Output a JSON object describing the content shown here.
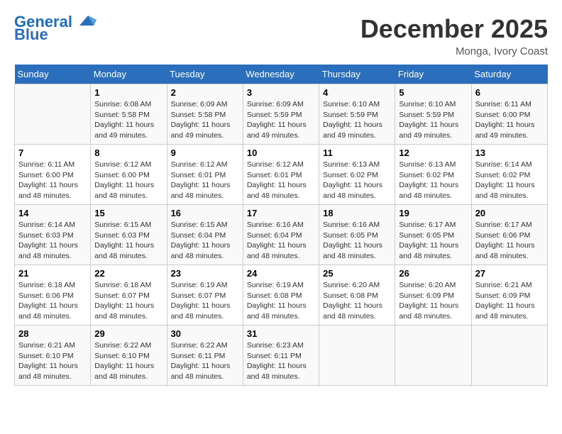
{
  "header": {
    "logo_line1": "General",
    "logo_line2": "Blue",
    "month_title": "December 2025",
    "location": "Monga, Ivory Coast"
  },
  "days_of_week": [
    "Sunday",
    "Monday",
    "Tuesday",
    "Wednesday",
    "Thursday",
    "Friday",
    "Saturday"
  ],
  "weeks": [
    [
      {
        "day": "",
        "info": ""
      },
      {
        "day": "1",
        "info": "Sunrise: 6:08 AM\nSunset: 5:58 PM\nDaylight: 11 hours and 49 minutes."
      },
      {
        "day": "2",
        "info": "Sunrise: 6:09 AM\nSunset: 5:58 PM\nDaylight: 11 hours and 49 minutes."
      },
      {
        "day": "3",
        "info": "Sunrise: 6:09 AM\nSunset: 5:59 PM\nDaylight: 11 hours and 49 minutes."
      },
      {
        "day": "4",
        "info": "Sunrise: 6:10 AM\nSunset: 5:59 PM\nDaylight: 11 hours and 49 minutes."
      },
      {
        "day": "5",
        "info": "Sunrise: 6:10 AM\nSunset: 5:59 PM\nDaylight: 11 hours and 49 minutes."
      },
      {
        "day": "6",
        "info": "Sunrise: 6:11 AM\nSunset: 6:00 PM\nDaylight: 11 hours and 49 minutes."
      }
    ],
    [
      {
        "day": "7",
        "info": "Sunrise: 6:11 AM\nSunset: 6:00 PM\nDaylight: 11 hours and 48 minutes."
      },
      {
        "day": "8",
        "info": "Sunrise: 6:12 AM\nSunset: 6:00 PM\nDaylight: 11 hours and 48 minutes."
      },
      {
        "day": "9",
        "info": "Sunrise: 6:12 AM\nSunset: 6:01 PM\nDaylight: 11 hours and 48 minutes."
      },
      {
        "day": "10",
        "info": "Sunrise: 6:12 AM\nSunset: 6:01 PM\nDaylight: 11 hours and 48 minutes."
      },
      {
        "day": "11",
        "info": "Sunrise: 6:13 AM\nSunset: 6:02 PM\nDaylight: 11 hours and 48 minutes."
      },
      {
        "day": "12",
        "info": "Sunrise: 6:13 AM\nSunset: 6:02 PM\nDaylight: 11 hours and 48 minutes."
      },
      {
        "day": "13",
        "info": "Sunrise: 6:14 AM\nSunset: 6:02 PM\nDaylight: 11 hours and 48 minutes."
      }
    ],
    [
      {
        "day": "14",
        "info": "Sunrise: 6:14 AM\nSunset: 6:03 PM\nDaylight: 11 hours and 48 minutes."
      },
      {
        "day": "15",
        "info": "Sunrise: 6:15 AM\nSunset: 6:03 PM\nDaylight: 11 hours and 48 minutes."
      },
      {
        "day": "16",
        "info": "Sunrise: 6:15 AM\nSunset: 6:04 PM\nDaylight: 11 hours and 48 minutes."
      },
      {
        "day": "17",
        "info": "Sunrise: 6:16 AM\nSunset: 6:04 PM\nDaylight: 11 hours and 48 minutes."
      },
      {
        "day": "18",
        "info": "Sunrise: 6:16 AM\nSunset: 6:05 PM\nDaylight: 11 hours and 48 minutes."
      },
      {
        "day": "19",
        "info": "Sunrise: 6:17 AM\nSunset: 6:05 PM\nDaylight: 11 hours and 48 minutes."
      },
      {
        "day": "20",
        "info": "Sunrise: 6:17 AM\nSunset: 6:06 PM\nDaylight: 11 hours and 48 minutes."
      }
    ],
    [
      {
        "day": "21",
        "info": "Sunrise: 6:18 AM\nSunset: 6:06 PM\nDaylight: 11 hours and 48 minutes."
      },
      {
        "day": "22",
        "info": "Sunrise: 6:18 AM\nSunset: 6:07 PM\nDaylight: 11 hours and 48 minutes."
      },
      {
        "day": "23",
        "info": "Sunrise: 6:19 AM\nSunset: 6:07 PM\nDaylight: 11 hours and 48 minutes."
      },
      {
        "day": "24",
        "info": "Sunrise: 6:19 AM\nSunset: 6:08 PM\nDaylight: 11 hours and 48 minutes."
      },
      {
        "day": "25",
        "info": "Sunrise: 6:20 AM\nSunset: 6:08 PM\nDaylight: 11 hours and 48 minutes."
      },
      {
        "day": "26",
        "info": "Sunrise: 6:20 AM\nSunset: 6:09 PM\nDaylight: 11 hours and 48 minutes."
      },
      {
        "day": "27",
        "info": "Sunrise: 6:21 AM\nSunset: 6:09 PM\nDaylight: 11 hours and 48 minutes."
      }
    ],
    [
      {
        "day": "28",
        "info": "Sunrise: 6:21 AM\nSunset: 6:10 PM\nDaylight: 11 hours and 48 minutes."
      },
      {
        "day": "29",
        "info": "Sunrise: 6:22 AM\nSunset: 6:10 PM\nDaylight: 11 hours and 48 minutes."
      },
      {
        "day": "30",
        "info": "Sunrise: 6:22 AM\nSunset: 6:11 PM\nDaylight: 11 hours and 48 minutes."
      },
      {
        "day": "31",
        "info": "Sunrise: 6:23 AM\nSunset: 6:11 PM\nDaylight: 11 hours and 48 minutes."
      },
      {
        "day": "",
        "info": ""
      },
      {
        "day": "",
        "info": ""
      },
      {
        "day": "",
        "info": ""
      }
    ]
  ]
}
